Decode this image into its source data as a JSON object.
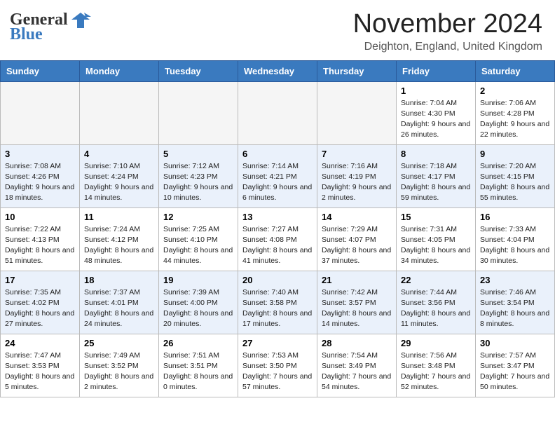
{
  "header": {
    "logo_g": "G",
    "logo_eneral": "eneral",
    "logo_blue": "Blue",
    "month": "November 2024",
    "location": "Deighton, England, United Kingdom"
  },
  "days_of_week": [
    "Sunday",
    "Monday",
    "Tuesday",
    "Wednesday",
    "Thursday",
    "Friday",
    "Saturday"
  ],
  "weeks": [
    [
      {
        "day": "",
        "info": ""
      },
      {
        "day": "",
        "info": ""
      },
      {
        "day": "",
        "info": ""
      },
      {
        "day": "",
        "info": ""
      },
      {
        "day": "",
        "info": ""
      },
      {
        "day": "1",
        "info": "Sunrise: 7:04 AM\nSunset: 4:30 PM\nDaylight: 9 hours and 26 minutes."
      },
      {
        "day": "2",
        "info": "Sunrise: 7:06 AM\nSunset: 4:28 PM\nDaylight: 9 hours and 22 minutes."
      }
    ],
    [
      {
        "day": "3",
        "info": "Sunrise: 7:08 AM\nSunset: 4:26 PM\nDaylight: 9 hours and 18 minutes."
      },
      {
        "day": "4",
        "info": "Sunrise: 7:10 AM\nSunset: 4:24 PM\nDaylight: 9 hours and 14 minutes."
      },
      {
        "day": "5",
        "info": "Sunrise: 7:12 AM\nSunset: 4:23 PM\nDaylight: 9 hours and 10 minutes."
      },
      {
        "day": "6",
        "info": "Sunrise: 7:14 AM\nSunset: 4:21 PM\nDaylight: 9 hours and 6 minutes."
      },
      {
        "day": "7",
        "info": "Sunrise: 7:16 AM\nSunset: 4:19 PM\nDaylight: 9 hours and 2 minutes."
      },
      {
        "day": "8",
        "info": "Sunrise: 7:18 AM\nSunset: 4:17 PM\nDaylight: 8 hours and 59 minutes."
      },
      {
        "day": "9",
        "info": "Sunrise: 7:20 AM\nSunset: 4:15 PM\nDaylight: 8 hours and 55 minutes."
      }
    ],
    [
      {
        "day": "10",
        "info": "Sunrise: 7:22 AM\nSunset: 4:13 PM\nDaylight: 8 hours and 51 minutes."
      },
      {
        "day": "11",
        "info": "Sunrise: 7:24 AM\nSunset: 4:12 PM\nDaylight: 8 hours and 48 minutes."
      },
      {
        "day": "12",
        "info": "Sunrise: 7:25 AM\nSunset: 4:10 PM\nDaylight: 8 hours and 44 minutes."
      },
      {
        "day": "13",
        "info": "Sunrise: 7:27 AM\nSunset: 4:08 PM\nDaylight: 8 hours and 41 minutes."
      },
      {
        "day": "14",
        "info": "Sunrise: 7:29 AM\nSunset: 4:07 PM\nDaylight: 8 hours and 37 minutes."
      },
      {
        "day": "15",
        "info": "Sunrise: 7:31 AM\nSunset: 4:05 PM\nDaylight: 8 hours and 34 minutes."
      },
      {
        "day": "16",
        "info": "Sunrise: 7:33 AM\nSunset: 4:04 PM\nDaylight: 8 hours and 30 minutes."
      }
    ],
    [
      {
        "day": "17",
        "info": "Sunrise: 7:35 AM\nSunset: 4:02 PM\nDaylight: 8 hours and 27 minutes."
      },
      {
        "day": "18",
        "info": "Sunrise: 7:37 AM\nSunset: 4:01 PM\nDaylight: 8 hours and 24 minutes."
      },
      {
        "day": "19",
        "info": "Sunrise: 7:39 AM\nSunset: 4:00 PM\nDaylight: 8 hours and 20 minutes."
      },
      {
        "day": "20",
        "info": "Sunrise: 7:40 AM\nSunset: 3:58 PM\nDaylight: 8 hours and 17 minutes."
      },
      {
        "day": "21",
        "info": "Sunrise: 7:42 AM\nSunset: 3:57 PM\nDaylight: 8 hours and 14 minutes."
      },
      {
        "day": "22",
        "info": "Sunrise: 7:44 AM\nSunset: 3:56 PM\nDaylight: 8 hours and 11 minutes."
      },
      {
        "day": "23",
        "info": "Sunrise: 7:46 AM\nSunset: 3:54 PM\nDaylight: 8 hours and 8 minutes."
      }
    ],
    [
      {
        "day": "24",
        "info": "Sunrise: 7:47 AM\nSunset: 3:53 PM\nDaylight: 8 hours and 5 minutes."
      },
      {
        "day": "25",
        "info": "Sunrise: 7:49 AM\nSunset: 3:52 PM\nDaylight: 8 hours and 2 minutes."
      },
      {
        "day": "26",
        "info": "Sunrise: 7:51 AM\nSunset: 3:51 PM\nDaylight: 8 hours and 0 minutes."
      },
      {
        "day": "27",
        "info": "Sunrise: 7:53 AM\nSunset: 3:50 PM\nDaylight: 7 hours and 57 minutes."
      },
      {
        "day": "28",
        "info": "Sunrise: 7:54 AM\nSunset: 3:49 PM\nDaylight: 7 hours and 54 minutes."
      },
      {
        "day": "29",
        "info": "Sunrise: 7:56 AM\nSunset: 3:48 PM\nDaylight: 7 hours and 52 minutes."
      },
      {
        "day": "30",
        "info": "Sunrise: 7:57 AM\nSunset: 3:47 PM\nDaylight: 7 hours and 50 minutes."
      }
    ]
  ]
}
